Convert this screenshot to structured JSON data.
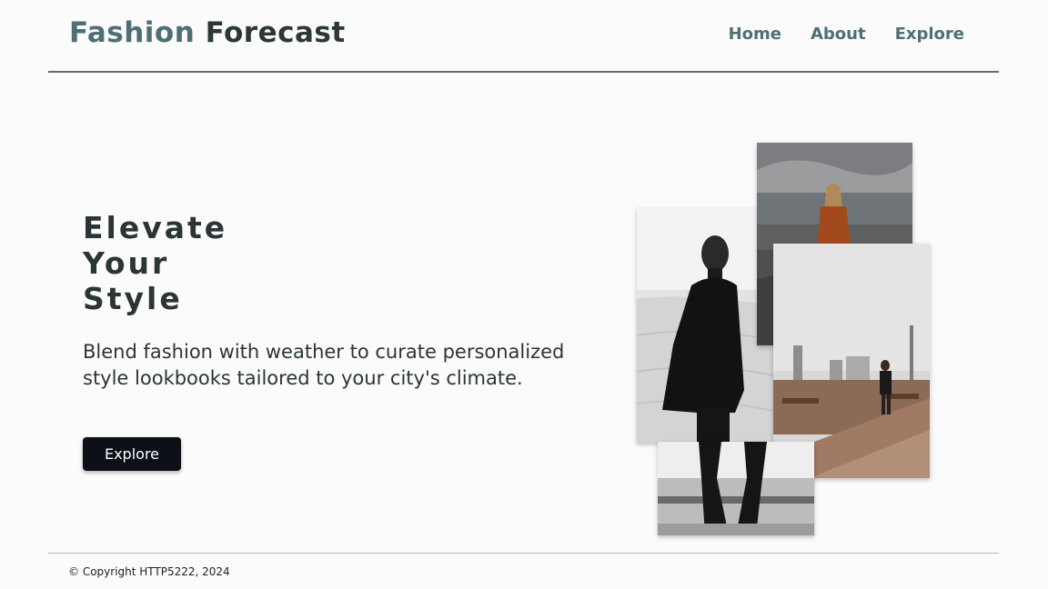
{
  "header": {
    "logo_part1": "Fashion",
    "logo_part2": "Forecast",
    "nav": [
      "Home",
      "About",
      "Explore"
    ]
  },
  "hero": {
    "title_lines": [
      "Elevate",
      "Your",
      "Style"
    ],
    "description": "Blend fashion with weather to curate personalized style lookbooks tailored to your city's climate.",
    "button_label": "Explore"
  },
  "collage": [
    {
      "alt": "Man in black coat on sand dunes"
    },
    {
      "alt": "Woman in orange coat by the sea"
    },
    {
      "alt": "Man in suit walking on city terrace"
    },
    {
      "alt": "Reflection of person in puddle"
    }
  ],
  "footer": {
    "copyright": "© Copyright HTTP5222, 2024"
  },
  "colors": {
    "accent": "#4f6f74",
    "text": "#2b3536",
    "button": "#0e1018",
    "background": "#fbfbfb"
  }
}
